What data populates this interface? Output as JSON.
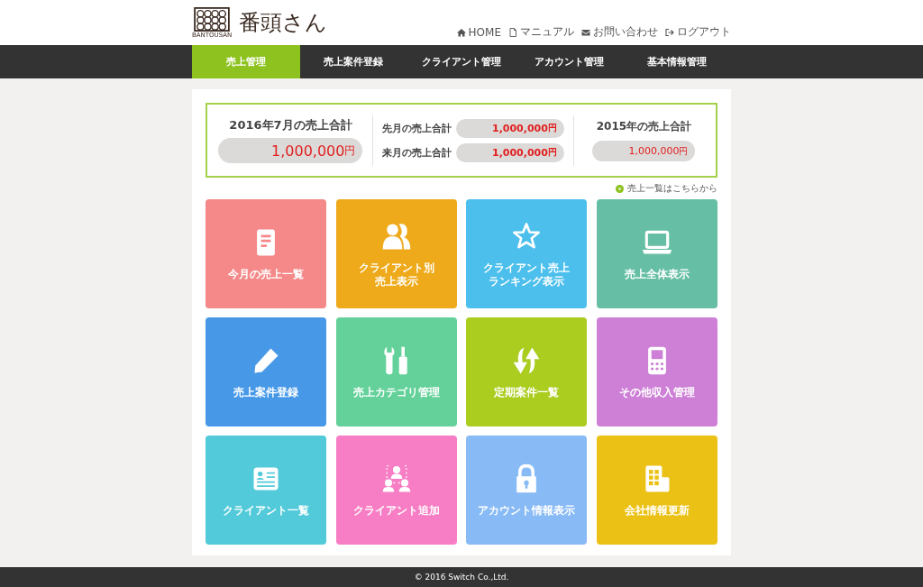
{
  "header": {
    "logo_subtext": "BANTOUSAN",
    "logo_text": "番頭さん",
    "links": [
      {
        "label": "HOME"
      },
      {
        "label": "マニュアル"
      },
      {
        "label": "お問い合わせ"
      },
      {
        "label": "ログアウト"
      }
    ]
  },
  "nav": [
    {
      "label": "売上管理",
      "selected": true
    },
    {
      "label": "売上案件登録",
      "selected": false
    },
    {
      "label": "クライアント管理",
      "selected": false
    },
    {
      "label": "アカウント管理",
      "selected": false
    },
    {
      "label": "基本情報管理",
      "selected": false
    }
  ],
  "summary": {
    "current": {
      "label": "2016年7月の売上合計",
      "amount": "1,000,000",
      "unit": "円"
    },
    "last_month": {
      "label": "先月の売上合計",
      "amount": "1,000,000",
      "unit": "円"
    },
    "next_month": {
      "label": "来月の売上合計",
      "amount": "1,000,000",
      "unit": "円"
    },
    "year": {
      "label": "2015年の売上合計",
      "amount": "1,000,000",
      "unit": "円"
    }
  },
  "list_link": "売上一覧はこちらから",
  "tiles": [
    {
      "label": "今月の売上一覧",
      "color": "#f58888"
    },
    {
      "label": "クライアント別",
      "label_line_2": "売上表示",
      "color": "#eeaa1a"
    },
    {
      "label": "クライアント売上",
      "label_line_2": "ランキング表示",
      "color": "#4cbfec"
    },
    {
      "label": "売上全体表示",
      "color": "#66bfa5"
    },
    {
      "label": "売上案件登録",
      "color": "#4799e8"
    },
    {
      "label": "売上カテゴリ管理",
      "color": "#63d199"
    },
    {
      "label": "定期案件一覧",
      "color": "#aacd20"
    },
    {
      "label": "その他収入管理",
      "color": "#cd80d6"
    },
    {
      "label": "クライアント一覧",
      "color": "#52cad9"
    },
    {
      "label": "クライアント追加",
      "color": "#f77ec4"
    },
    {
      "label": "アカウント情報表示",
      "color": "#88baf5"
    },
    {
      "label": "会社情報更新",
      "color": "#ebc115"
    }
  ],
  "footer": "© 2016 Switch Co.,Ltd."
}
